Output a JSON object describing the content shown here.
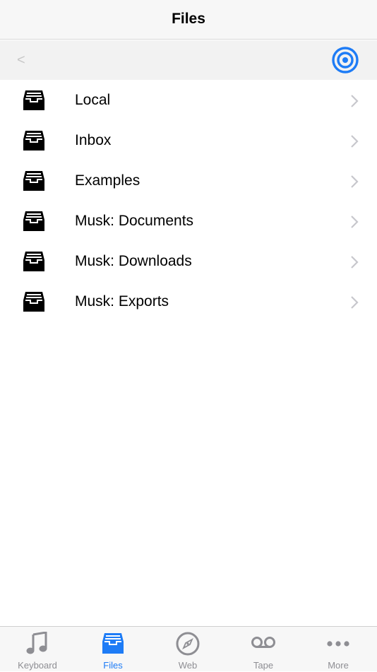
{
  "header": {
    "title": "Files"
  },
  "toolbar": {
    "back_glyph": "<",
    "back_icon": "chevron-left-icon",
    "target_icon": "target-icon"
  },
  "folders": [
    {
      "label": "Local",
      "icon": "drawer-icon"
    },
    {
      "label": "Inbox",
      "icon": "drawer-icon"
    },
    {
      "label": "Examples",
      "icon": "drawer-icon"
    },
    {
      "label": "Musk: Documents",
      "icon": "drawer-icon"
    },
    {
      "label": "Musk: Downloads",
      "icon": "drawer-icon"
    },
    {
      "label": "Musk: Exports",
      "icon": "drawer-icon"
    }
  ],
  "tabs": [
    {
      "label": "Keyboard",
      "icon": "music-note-icon",
      "active": false
    },
    {
      "label": "Files",
      "icon": "drawer-icon",
      "active": true
    },
    {
      "label": "Web",
      "icon": "compass-icon",
      "active": false
    },
    {
      "label": "Tape",
      "icon": "voicemail-icon",
      "active": false
    },
    {
      "label": "More",
      "icon": "more-dots-icon",
      "active": false
    }
  ],
  "colors": {
    "accent": "#1e7cf6",
    "inactive": "#8e8e93",
    "chevron": "#c7c7cc",
    "disabled": "#c7c7c7"
  }
}
